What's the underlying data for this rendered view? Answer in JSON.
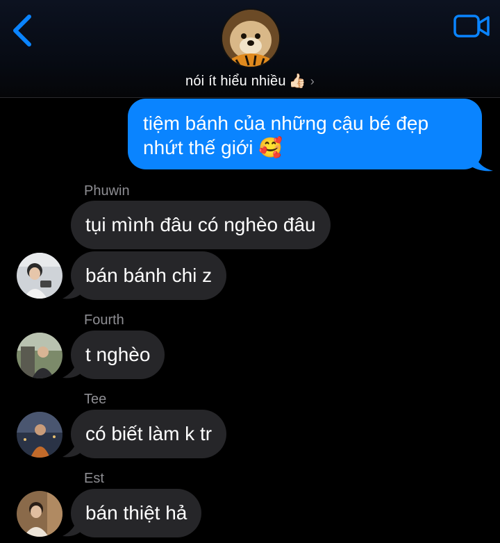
{
  "header": {
    "title": "nói ít hiểu nhiều",
    "title_emoji": "👍🏻",
    "chevron": "›",
    "back_icon": "chevron-left",
    "video_icon": "video-camera",
    "accent": "#0a84ff"
  },
  "messages": {
    "outgoing_1": "tiệm bánh của những cậu bé đẹp nhứt thế giới",
    "outgoing_1_emoji": "🥰",
    "sender_phuwin": "Phuwin",
    "phuwin_1": "tụi mình đâu có nghèo đâu",
    "phuwin_2": "bán bánh chi z",
    "sender_fourth": "Fourth",
    "fourth_1": "t nghèo",
    "sender_tee": "Tee",
    "tee_1": "có biết làm k tr",
    "sender_est": "Est",
    "est_1": "bán thiệt hả"
  },
  "colors": {
    "outgoing_bubble": "#0a84ff",
    "incoming_bubble": "#262629",
    "sender_name": "#8e8e93"
  }
}
